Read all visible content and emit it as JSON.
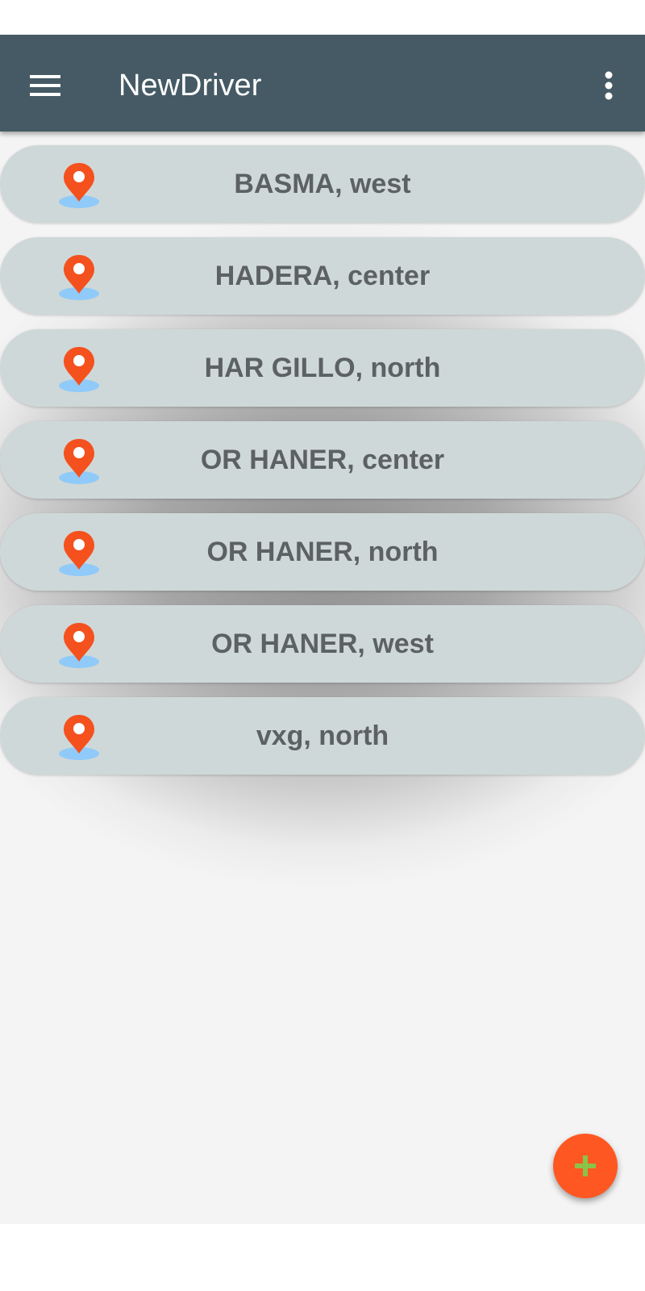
{
  "app_bar": {
    "title": "NewDriver",
    "background_color": "#455a64",
    "menu_icon": "hamburger-menu-icon",
    "overflow_icon": "more-vert-icon"
  },
  "locations": [
    {
      "label": "BASMA, west",
      "icon": "location-pin-icon"
    },
    {
      "label": "HADERA, center",
      "icon": "location-pin-icon"
    },
    {
      "label": "HAR GILLO, north",
      "icon": "location-pin-icon"
    },
    {
      "label": "OR HANER, center",
      "icon": "location-pin-icon"
    },
    {
      "label": "OR HANER, north",
      "icon": "location-pin-icon"
    },
    {
      "label": "OR HANER, west",
      "icon": "location-pin-icon"
    },
    {
      "label": "vxg, north",
      "icon": "location-pin-icon"
    }
  ],
  "fab": {
    "icon": "plus-icon",
    "background_color": "#ff5722",
    "icon_color": "#8bc34a"
  },
  "colors": {
    "item_background": "#cfd8d8",
    "item_text": "#5c6163",
    "pin_red": "#f4511e",
    "pin_shadow": "#90caf9"
  }
}
